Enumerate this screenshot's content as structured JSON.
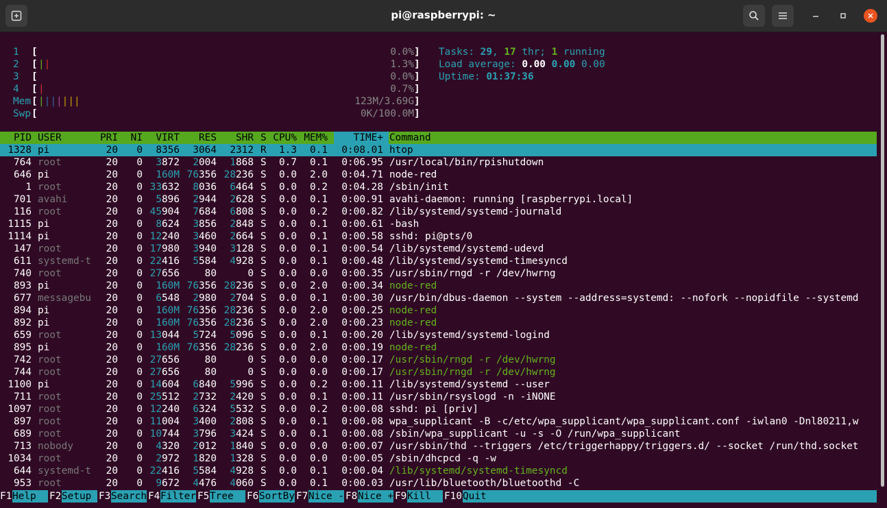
{
  "window": {
    "title": "pi@raspberrypi: ~",
    "colors": {
      "bg": "#300a24",
      "titlebar": "#2c2c2c",
      "close": "#e95420",
      "cyan": "#2aa1b3",
      "green": "#64b21e"
    }
  },
  "meters": {
    "cpus": [
      {
        "label": "1",
        "bars": "",
        "value": "0.0%"
      },
      {
        "label": "2",
        "bars": "||",
        "value": "1.3%"
      },
      {
        "label": "3",
        "bars": "",
        "value": "0.0%"
      },
      {
        "label": "4",
        "bars": "|",
        "value": "0.7%"
      }
    ],
    "mem": {
      "label": "Mem",
      "bars": "|||||||",
      "value": "123M/3.69G"
    },
    "swp": {
      "label": "Swp",
      "bars": "",
      "value": "0K/100.0M"
    }
  },
  "stats": {
    "tasks_label": "Tasks:",
    "tasks": "29",
    "thr": "17",
    "thr_label": "thr;",
    "running": "1",
    "running_label": "running",
    "load_label": "Load average:",
    "load1": "0.00",
    "load5": "0.00",
    "load15": "0.00",
    "uptime_label": "Uptime:",
    "uptime": "01:37:36"
  },
  "table": {
    "columns": [
      "PID",
      "USER",
      "PRI",
      "NI",
      "VIRT",
      "RES",
      "SHR",
      "S",
      "CPU%",
      "MEM%",
      "TIME+",
      "Command"
    ],
    "rows": [
      [
        "1328",
        "pi",
        "20",
        "0",
        "8356",
        "3064",
        "2312",
        "R",
        "1.3",
        "0.1",
        "0:08.01",
        "htop"
      ],
      [
        "764",
        "root",
        "20",
        "0",
        "3872",
        "2004",
        "1868",
        "S",
        "0.7",
        "0.1",
        "0:06.95",
        "/usr/local/bin/rpishutdown"
      ],
      [
        "646",
        "pi",
        "20",
        "0",
        "160M",
        "76356",
        "28236",
        "S",
        "0.0",
        "2.0",
        "0:04.71",
        "node-red"
      ],
      [
        "1",
        "root",
        "20",
        "0",
        "33632",
        "8036",
        "6464",
        "S",
        "0.0",
        "0.2",
        "0:04.28",
        "/sbin/init"
      ],
      [
        "701",
        "avahi",
        "20",
        "0",
        "5896",
        "2944",
        "2628",
        "S",
        "0.0",
        "0.1",
        "0:00.91",
        "avahi-daemon: running [raspberrypi.local]"
      ],
      [
        "116",
        "root",
        "20",
        "0",
        "45904",
        "7684",
        "6808",
        "S",
        "0.0",
        "0.2",
        "0:00.82",
        "/lib/systemd/systemd-journald"
      ],
      [
        "1115",
        "pi",
        "20",
        "0",
        "8624",
        "3856",
        "2848",
        "S",
        "0.0",
        "0.1",
        "0:00.61",
        "-bash"
      ],
      [
        "1114",
        "pi",
        "20",
        "0",
        "12240",
        "3460",
        "2664",
        "S",
        "0.0",
        "0.1",
        "0:00.58",
        "sshd: pi@pts/0"
      ],
      [
        "147",
        "root",
        "20",
        "0",
        "17980",
        "3940",
        "3128",
        "S",
        "0.0",
        "0.1",
        "0:00.54",
        "/lib/systemd/systemd-udevd"
      ],
      [
        "611",
        "systemd-t",
        "20",
        "0",
        "22416",
        "5584",
        "4928",
        "S",
        "0.0",
        "0.1",
        "0:00.48",
        "/lib/systemd/systemd-timesyncd"
      ],
      [
        "740",
        "root",
        "20",
        "0",
        "27656",
        "80",
        "0",
        "S",
        "0.0",
        "0.0",
        "0:00.35",
        "/usr/sbin/rngd -r /dev/hwrng"
      ],
      [
        "893",
        "pi",
        "20",
        "0",
        "160M",
        "76356",
        "28236",
        "S",
        "0.0",
        "2.0",
        "0:00.34",
        "node-red"
      ],
      [
        "677",
        "messagebu",
        "20",
        "0",
        "6548",
        "2980",
        "2704",
        "S",
        "0.0",
        "0.1",
        "0:00.30",
        "/usr/bin/dbus-daemon --system --address=systemd: --nofork --nopidfile --systemd"
      ],
      [
        "894",
        "pi",
        "20",
        "0",
        "160M",
        "76356",
        "28236",
        "S",
        "0.0",
        "2.0",
        "0:00.25",
        "node-red"
      ],
      [
        "892",
        "pi",
        "20",
        "0",
        "160M",
        "76356",
        "28236",
        "S",
        "0.0",
        "2.0",
        "0:00.23",
        "node-red"
      ],
      [
        "659",
        "root",
        "20",
        "0",
        "13044",
        "5724",
        "5096",
        "S",
        "0.0",
        "0.1",
        "0:00.20",
        "/lib/systemd/systemd-logind"
      ],
      [
        "895",
        "pi",
        "20",
        "0",
        "160M",
        "76356",
        "28236",
        "S",
        "0.0",
        "2.0",
        "0:00.19",
        "node-red"
      ],
      [
        "742",
        "root",
        "20",
        "0",
        "27656",
        "80",
        "0",
        "S",
        "0.0",
        "0.0",
        "0:00.17",
        "/usr/sbin/rngd -r /dev/hwrng"
      ],
      [
        "744",
        "root",
        "20",
        "0",
        "27656",
        "80",
        "0",
        "S",
        "0.0",
        "0.0",
        "0:00.17",
        "/usr/sbin/rngd -r /dev/hwrng"
      ],
      [
        "1100",
        "pi",
        "20",
        "0",
        "14604",
        "6840",
        "5996",
        "S",
        "0.0",
        "0.2",
        "0:00.11",
        "/lib/systemd/systemd --user"
      ],
      [
        "711",
        "root",
        "20",
        "0",
        "25512",
        "2732",
        "2420",
        "S",
        "0.0",
        "0.1",
        "0:00.11",
        "/usr/sbin/rsyslogd -n -iNONE"
      ],
      [
        "1097",
        "root",
        "20",
        "0",
        "12240",
        "6324",
        "5532",
        "S",
        "0.0",
        "0.2",
        "0:00.08",
        "sshd: pi [priv]"
      ],
      [
        "897",
        "root",
        "20",
        "0",
        "11004",
        "3400",
        "2808",
        "S",
        "0.0",
        "0.1",
        "0:00.08",
        "wpa_supplicant -B -c/etc/wpa_supplicant/wpa_supplicant.conf -iwlan0 -Dnl80211,w"
      ],
      [
        "689",
        "root",
        "20",
        "0",
        "10744",
        "3796",
        "3424",
        "S",
        "0.0",
        "0.1",
        "0:00.08",
        "/sbin/wpa_supplicant -u -s -O /run/wpa_supplicant"
      ],
      [
        "713",
        "nobody",
        "20",
        "0",
        "4320",
        "2012",
        "1840",
        "S",
        "0.0",
        "0.0",
        "0:00.07",
        "/usr/sbin/thd --triggers /etc/triggerhappy/triggers.d/ --socket /run/thd.socket"
      ],
      [
        "1034",
        "root",
        "20",
        "0",
        "2972",
        "1820",
        "1328",
        "S",
        "0.0",
        "0.0",
        "0:00.05",
        "/sbin/dhcpcd -q -w"
      ],
      [
        "644",
        "systemd-t",
        "20",
        "0",
        "22416",
        "5584",
        "4928",
        "S",
        "0.0",
        "0.1",
        "0:00.04",
        "/lib/systemd/systemd-timesyncd"
      ],
      [
        "953",
        "root",
        "20",
        "0",
        "9672",
        "4476",
        "4060",
        "S",
        "0.0",
        "0.1",
        "0:00.03",
        "/usr/lib/bluetooth/bluetoothd -C"
      ]
    ],
    "thread_rows": [
      11,
      13,
      14,
      16,
      17,
      18,
      26
    ]
  },
  "footer": [
    {
      "key": "F1",
      "label": "Help  "
    },
    {
      "key": "F2",
      "label": "Setup "
    },
    {
      "key": "F3",
      "label": "Search"
    },
    {
      "key": "F4",
      "label": "Filter"
    },
    {
      "key": "F5",
      "label": "Tree  "
    },
    {
      "key": "F6",
      "label": "SortBy"
    },
    {
      "key": "F7",
      "label": "Nice -"
    },
    {
      "key": "F8",
      "label": "Nice +"
    },
    {
      "key": "F9",
      "label": "Kill  "
    },
    {
      "key": "F10",
      "label": "Quit"
    }
  ]
}
